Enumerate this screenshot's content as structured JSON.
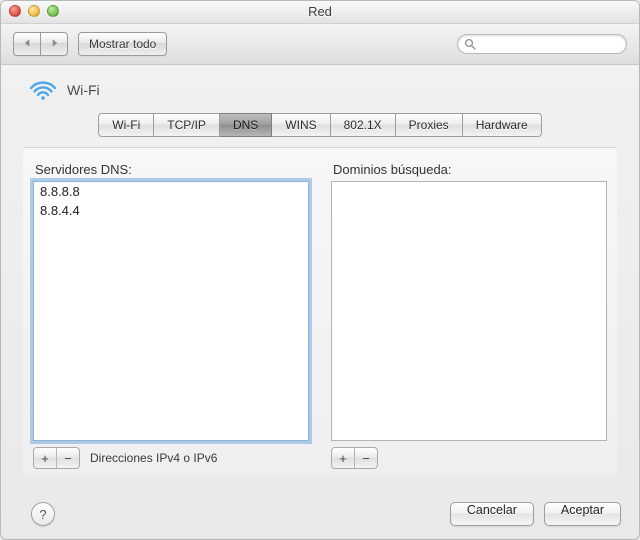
{
  "window": {
    "title": "Red"
  },
  "toolbar": {
    "back_icon": "triangle-left",
    "forward_icon": "triangle-right",
    "show_all_label": "Mostrar todo",
    "search_placeholder": ""
  },
  "service": {
    "name": "Wi-Fi",
    "icon": "wifi-icon"
  },
  "tabs": [
    {
      "label": "Wi-Fi",
      "selected": false
    },
    {
      "label": "TCP/IP",
      "selected": false
    },
    {
      "label": "DNS",
      "selected": true
    },
    {
      "label": "WINS",
      "selected": false
    },
    {
      "label": "802.1X",
      "selected": false
    },
    {
      "label": "Proxies",
      "selected": false
    },
    {
      "label": "Hardware",
      "selected": false
    }
  ],
  "dns": {
    "servers_label": "Servidores DNS:",
    "servers": [
      "8.8.8.8",
      "8.8.4.4"
    ],
    "add_label": "+",
    "remove_label": "−",
    "hint": "Direcciones IPv4 o IPv6"
  },
  "search_domains": {
    "label": "Dominios búsqueda:",
    "items": [],
    "add_label": "+",
    "remove_label": "−"
  },
  "buttons": {
    "help": "?",
    "cancel": "Cancelar",
    "ok": "Aceptar"
  }
}
